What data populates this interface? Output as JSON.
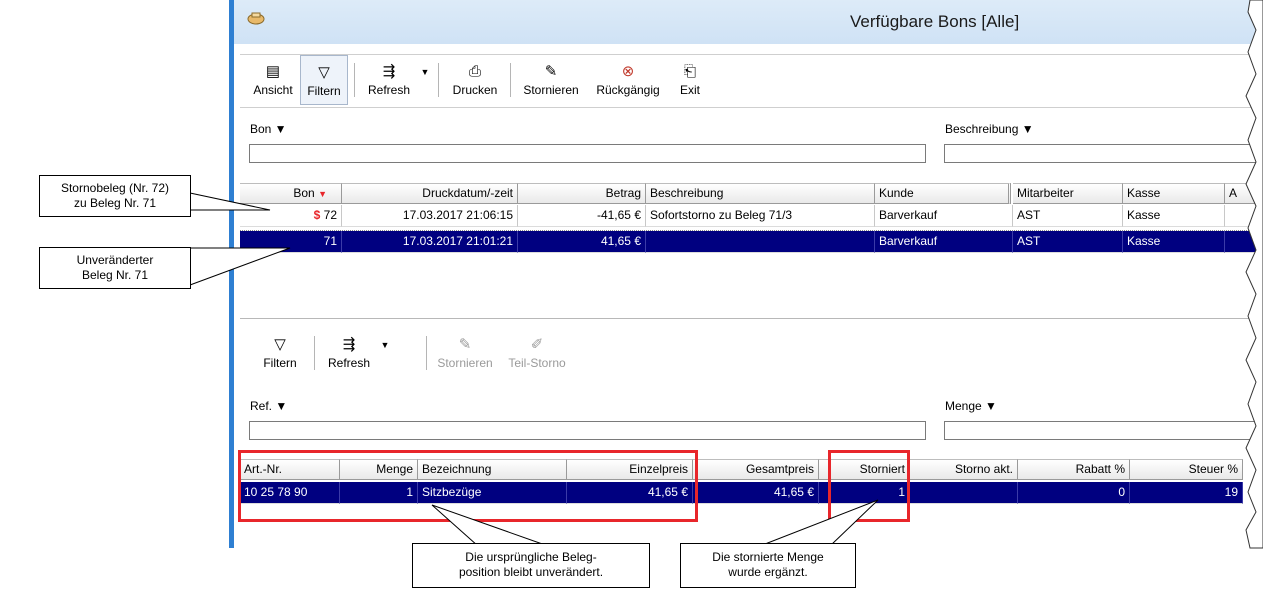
{
  "window": {
    "title": "Verfügbare Bons [Alle]"
  },
  "toolbar": {
    "buttons": [
      {
        "label": "Ansicht"
      },
      {
        "label": "Filtern"
      },
      {
        "label": "Refresh"
      },
      {
        "label": "Drucken"
      },
      {
        "label": "Stornieren"
      },
      {
        "label": "Rückgängig"
      },
      {
        "label": "Exit"
      }
    ]
  },
  "top_filters": {
    "bon_label": "Bon ▼",
    "beschreibung_label": "Beschreibung ▼"
  },
  "bons_table": {
    "columns": [
      "Bon",
      "Druckdatum/-zeit",
      "Betrag",
      "Beschreibung",
      "Kunde",
      "Mitarbeiter",
      "Kasse",
      "A"
    ],
    "sort_marker": "▼",
    "rows": [
      {
        "storno_flag": "$",
        "bon": "72",
        "datum": "17.03.2017 21:06:15",
        "betrag": "-41,65 €",
        "beschreibung": "Sofortstorno zu Beleg 71/3",
        "kunde": "Barverkauf",
        "mitarbeiter": "AST",
        "kasse": "Kasse"
      },
      {
        "storno_flag": "",
        "bon": "71",
        "datum": "17.03.2017 21:01:21",
        "betrag": "41,65 €",
        "beschreibung": "",
        "kunde": "Barverkauf",
        "mitarbeiter": "AST",
        "kasse": "Kasse"
      }
    ]
  },
  "bottom_toolbar": {
    "buttons": [
      {
        "label": "Filtern"
      },
      {
        "label": "Refresh"
      },
      {
        "label": "Stornieren"
      },
      {
        "label": "Teil-Storno"
      }
    ]
  },
  "bottom_filters": {
    "ref_label": "Ref. ▼",
    "menge_label": "Menge ▼"
  },
  "positions_table": {
    "columns": [
      "Art.-Nr.",
      "Menge",
      "Bezeichnung",
      "Einzelpreis",
      "Gesamtpreis",
      "Storniert",
      "Storno akt.",
      "Rabatt %",
      "Steuer %"
    ],
    "rows": [
      {
        "artnr": "10 25 78 90",
        "menge": "1",
        "bezeichnung": "Sitzbezüge",
        "einzelpreis": "41,65 €",
        "gesamtpreis": "41,65 €",
        "storniert": "1",
        "storno_akt": "",
        "rabatt": "0",
        "steuer": "19"
      }
    ]
  },
  "callouts": {
    "c1": [
      "Stornobeleg (Nr. 72)",
      "zu Beleg Nr. 71"
    ],
    "c2": [
      "Unveränderter",
      "Beleg Nr. 71"
    ],
    "c3": [
      "Die ursprüngliche Beleg-",
      "position bleibt unverändert."
    ],
    "c4": [
      "Die stornierte Menge",
      "wurde ergänzt."
    ]
  },
  "colors": {
    "selection": "#000080",
    "highlight_box": "#e8262b",
    "storno_flag": "#e8262b"
  }
}
